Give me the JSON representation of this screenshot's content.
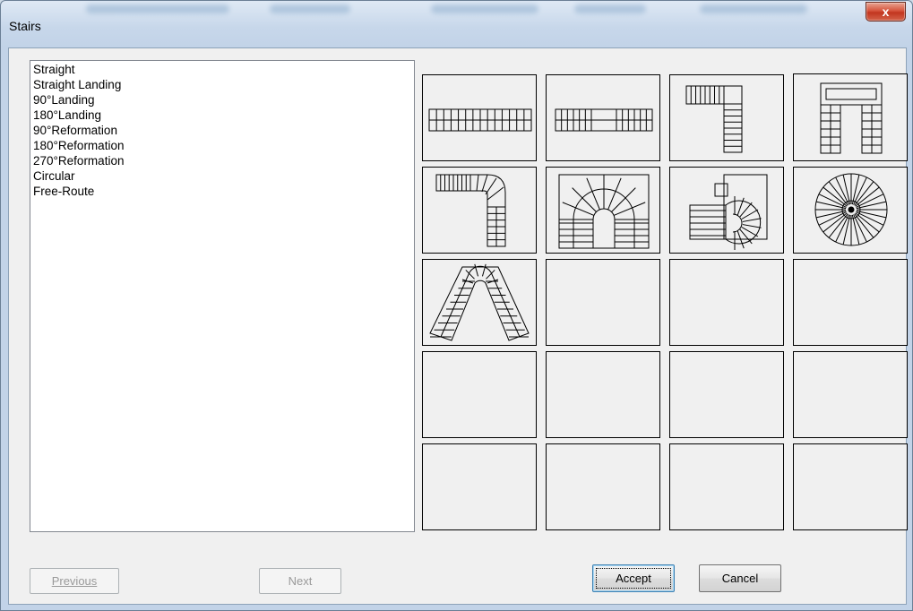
{
  "window": {
    "title": "Stairs",
    "close_label": "x"
  },
  "stair_types": [
    "Straight",
    "Straight Landing",
    "90°Landing",
    "180°Landing",
    "90°Reformation",
    "180°Reformation",
    "270°Reformation",
    "Circular",
    "Free-Route"
  ],
  "previews": [
    "straight",
    "straight-landing",
    "90-landing",
    "180-landing",
    "90-reformation",
    "180-reformation",
    "270-reformation",
    "circular",
    "free-route",
    "empty",
    "empty",
    "empty",
    "empty",
    "empty",
    "empty",
    "empty",
    "empty",
    "empty",
    "empty",
    "empty"
  ],
  "buttons": {
    "previous": "Previous",
    "next": "Next",
    "accept": "Accept",
    "cancel": "Cancel"
  },
  "colors": {
    "client_bg": "#f0f0f0",
    "close_button": "#c7432c",
    "frame": "#c2d3e8"
  }
}
